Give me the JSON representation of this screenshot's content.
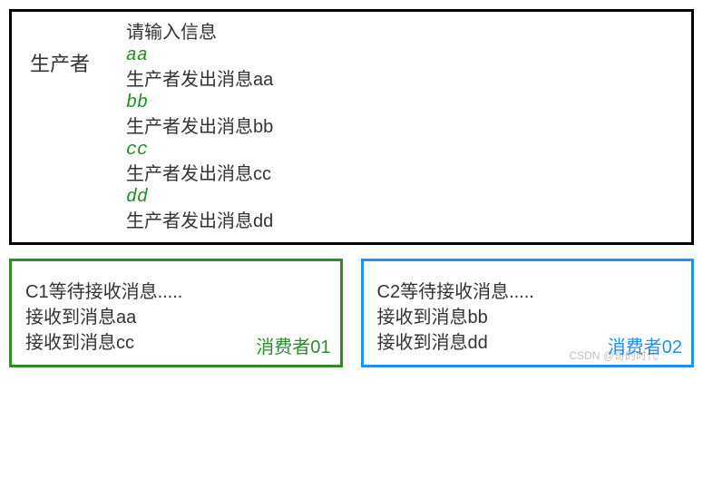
{
  "producer": {
    "label": "生产者",
    "prompt": "请输入信息",
    "entries": [
      {
        "input": "aa",
        "output": "生产者发出消息aa"
      },
      {
        "input": "bb",
        "output": "生产者发出消息bb"
      },
      {
        "input": "cc",
        "output": "生产者发出消息cc"
      },
      {
        "input": "dd",
        "output": "生产者发出消息dd"
      }
    ]
  },
  "consumers": [
    {
      "label": "消费者01",
      "wait": "C1等待接收消息.....",
      "received": [
        "接收到消息aa",
        "接收到消息cc"
      ]
    },
    {
      "label": "消费者02",
      "wait": "C2等待接收消息.....",
      "received": [
        "接收到消息bb",
        "接收到消息dd"
      ]
    }
  ],
  "watermark": "CSDN @哥的时代"
}
